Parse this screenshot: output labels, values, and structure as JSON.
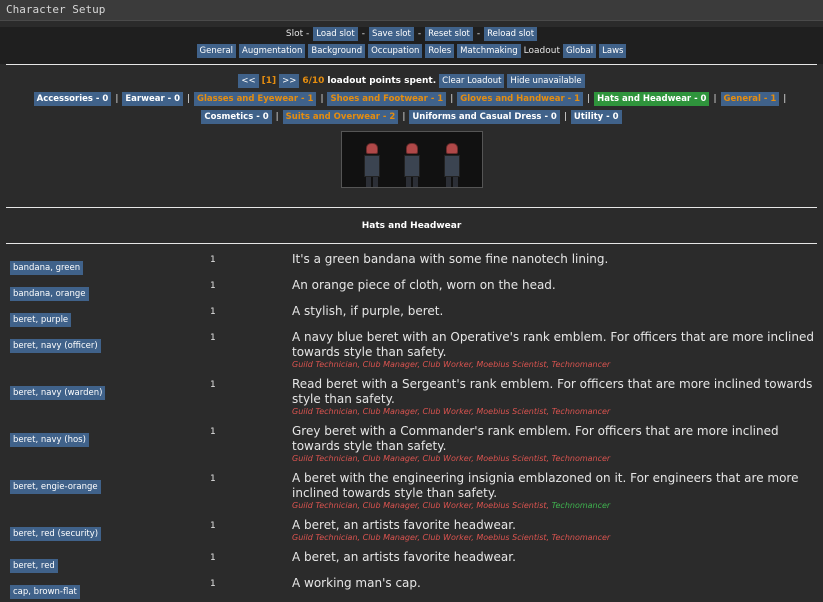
{
  "window": {
    "title": "Character Setup"
  },
  "slot": {
    "label": "Slot -",
    "buttons": [
      "Load slot",
      "Save slot",
      "Reset slot",
      "Reload slot"
    ]
  },
  "nav": {
    "tabs": [
      "General",
      "Augmentation",
      "Background",
      "Occupation",
      "Roles",
      "Matchmaking"
    ],
    "current": "Loadout",
    "after": [
      "Global",
      "Laws"
    ]
  },
  "loadout": {
    "prev": "<<",
    "page": "[1]",
    "next": ">>",
    "points": "6/10",
    "points_suffix": "loadout points spent.",
    "clear": "Clear Loadout",
    "hide": "Hide unavailable"
  },
  "categories": [
    {
      "label": "Accessories - 0",
      "style": "normal"
    },
    {
      "label": "Earwear - 0",
      "style": "normal"
    },
    {
      "label": "Glasses and Eyewear - 1",
      "style": "orange"
    },
    {
      "label": "Shoes and Footwear - 1",
      "style": "orange"
    },
    {
      "label": "Gloves and Handwear - 1",
      "style": "orange"
    },
    {
      "label": "Hats and Headwear - 0",
      "style": "green"
    },
    {
      "label": "General - 1",
      "style": "orange"
    },
    {
      "label": "Cosmetics - 0",
      "style": "normal"
    },
    {
      "label": "Suits and Overwear - 2",
      "style": "orange"
    },
    {
      "label": "Uniforms and Casual Dress - 0",
      "style": "normal"
    },
    {
      "label": "Utility - 0",
      "style": "normal"
    }
  ],
  "category_separator": "|",
  "section_title": "Hats and Headwear",
  "items": [
    {
      "name": "bandana, green",
      "cost": "1",
      "desc": "It's a green bandana with some fine nanotech lining.",
      "roles": []
    },
    {
      "name": "bandana, orange",
      "cost": "1",
      "desc": "An orange piece of cloth, worn on the head.",
      "roles": []
    },
    {
      "name": "beret, purple",
      "cost": "1",
      "desc": "A stylish, if purple, beret.",
      "roles": []
    },
    {
      "name": "beret, navy (officer)",
      "cost": "1",
      "desc": "A navy blue beret with an Operative's rank emblem. For officers that are more inclined towards style than safety.",
      "roles": [
        {
          "text": "Guild Technician",
          "ok": false
        },
        {
          "text": "Club Manager",
          "ok": false
        },
        {
          "text": "Club Worker",
          "ok": false
        },
        {
          "text": "Moebius Scientist",
          "ok": false
        },
        {
          "text": "Technomancer",
          "ok": false
        }
      ]
    },
    {
      "name": "beret, navy (warden)",
      "cost": "1",
      "desc": "Read beret with a Sergeant's rank emblem. For officers that are more inclined towards style than safety.",
      "roles": [
        {
          "text": "Guild Technician",
          "ok": false
        },
        {
          "text": "Club Manager",
          "ok": false
        },
        {
          "text": "Club Worker",
          "ok": false
        },
        {
          "text": "Moebius Scientist",
          "ok": false
        },
        {
          "text": "Technomancer",
          "ok": false
        }
      ]
    },
    {
      "name": "beret, navy (hos)",
      "cost": "1",
      "desc": "Grey beret with a Commander's rank emblem. For officers that are more inclined towards style than safety.",
      "roles": [
        {
          "text": "Guild Technician",
          "ok": false
        },
        {
          "text": "Club Manager",
          "ok": false
        },
        {
          "text": "Club Worker",
          "ok": false
        },
        {
          "text": "Moebius Scientist",
          "ok": false
        },
        {
          "text": "Technomancer",
          "ok": false
        }
      ]
    },
    {
      "name": "beret, engie-orange",
      "cost": "1",
      "desc": "A beret with the engineering insignia emblazoned on it. For engineers that are more inclined towards style than safety.",
      "roles": [
        {
          "text": "Guild Technician",
          "ok": false
        },
        {
          "text": "Club Manager",
          "ok": false
        },
        {
          "text": "Club Worker",
          "ok": false
        },
        {
          "text": "Moebius Scientist",
          "ok": false
        },
        {
          "text": "Technomancer",
          "ok": true
        }
      ]
    },
    {
      "name": "beret, red (security)",
      "cost": "1",
      "desc": "A beret, an artists favorite headwear.",
      "roles": [
        {
          "text": "Guild Technician",
          "ok": false
        },
        {
          "text": "Club Manager",
          "ok": false
        },
        {
          "text": "Club Worker",
          "ok": false
        },
        {
          "text": "Moebius Scientist",
          "ok": false
        },
        {
          "text": "Technomancer",
          "ok": false
        }
      ]
    },
    {
      "name": "beret, red",
      "cost": "1",
      "desc": "A beret, an artists favorite headwear.",
      "roles": []
    },
    {
      "name": "cap, brown-flat",
      "cost": "1",
      "desc": "A working man's cap.",
      "roles": []
    }
  ],
  "colors": {
    "button": "#40628a",
    "active": "#2f943c",
    "warning": "#e58d0f",
    "restricted": "#d9534f",
    "allowed": "#3fb34f"
  }
}
